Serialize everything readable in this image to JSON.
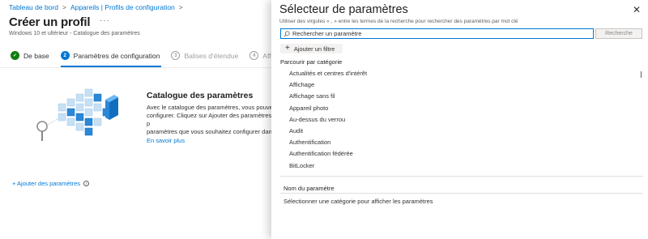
{
  "breadcrumb": [
    "Tableau de bord",
    "Appareils | Profils de configuration"
  ],
  "breadcrumb_sep": ">",
  "page": {
    "title": "Créer un profil",
    "more": "···",
    "subtitle": "Windows 10 et ultérieur - Catalogue des paramètres"
  },
  "steps": [
    {
      "label": "De base",
      "marker": "✓",
      "state": "done"
    },
    {
      "label": "Paramètres de configuration",
      "marker": "2",
      "state": "active"
    },
    {
      "label": "Balises d'étendue",
      "marker": "3",
      "state": "pending"
    },
    {
      "label": "Affec",
      "marker": "4",
      "state": "pending"
    }
  ],
  "catalog": {
    "title": "Catalogue des paramètres",
    "body": "Avec le catalogue des paramètres, vous pouvez\nconfigurer. Cliquez sur Ajouter des paramètres p\nparamètres que vous souhaitez configurer dans\neffectuez une recherche dans celui-ci.",
    "learn_more": "En savoir plus"
  },
  "add_settings": "+ Ajouter des paramètres",
  "panel": {
    "title": "Sélecteur de paramètres",
    "close_icon": "close-icon",
    "hint": "Utiliser des virgules « , » entre les termes de la recherche pour rechercher des paramètres par mot clé",
    "search_placeholder": "Rechercher un paramètre",
    "search_button": "Recherche",
    "add_filter_plus": "+",
    "add_filter": "Ajouter un filtre",
    "browse_label": "Parcourir par catégorie",
    "categories": [
      "Actualités et centres d'intérêt",
      "Affichage",
      "Affichage sans fil",
      "Appareil photo",
      "Au-dessus du verrou",
      "Audit",
      "Authentification",
      "Authentification fédérée",
      "BitLocker"
    ],
    "column_header": "Nom du paramètre",
    "empty_message": "Sélectionner une catégorie pour afficher les paramètres"
  },
  "colors": {
    "accent": "#0078d4",
    "done": "#107c10",
    "illustration_blue": "#2b88d8"
  }
}
